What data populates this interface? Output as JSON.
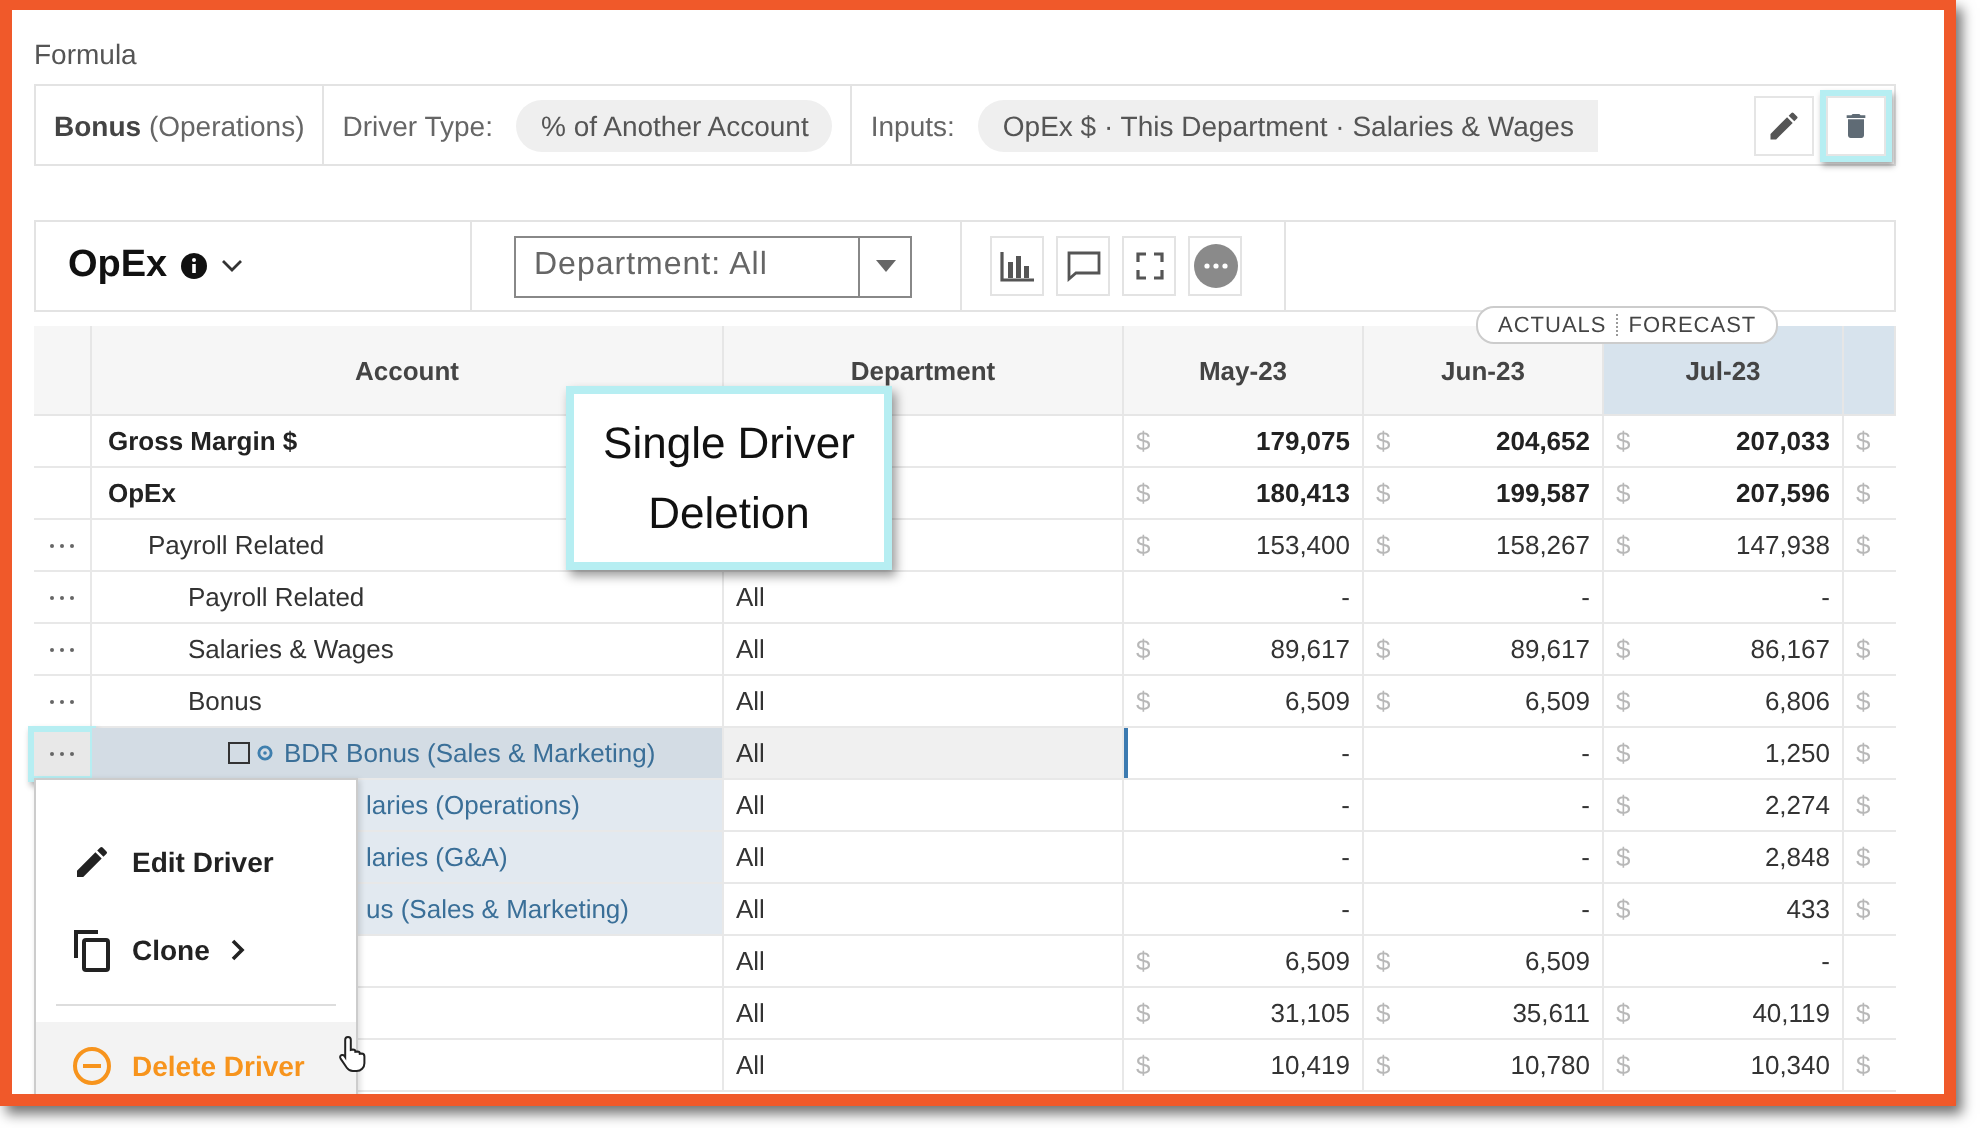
{
  "formula": {
    "label": "Formula",
    "account": "**Bonus** (Operations)",
    "driver_type_label": "Driver Type:",
    "driver_type": "% of Another Account",
    "inputs_label": "Inputs:",
    "inputs": "OpEx $ · This Department · Salaries & Wages",
    "delete_highlighted": true
  },
  "toolbar": {
    "title": "OpEx",
    "department_select": "Department: All"
  },
  "period_pill": {
    "left": "ACTUALS",
    "right": "FORECAST"
  },
  "columns": [
    {
      "forecast": false
    },
    {
      "label": "Account",
      "forecast": false
    },
    {
      "label": "Department",
      "forecast": false
    },
    {
      "label": "May-23",
      "forecast": false
    },
    {
      "label": "Jun-23",
      "forecast": false
    },
    {
      "label": "Jul-23",
      "forecast": true
    },
    {
      "forecast": true
    }
  ],
  "rows": [
    {
      "kind": "account",
      "account": "Gross Margin $",
      "bold": true,
      "menu": false,
      "selected": false,
      "values": [
        {
          "sign": "$",
          "value": "179,075"
        },
        {
          "sign": "$",
          "value": "204,652"
        },
        {
          "sign": "$",
          "value": "207,033"
        },
        {
          "sign": "$"
        }
      ]
    },
    {
      "kind": "account",
      "account": "OpEx",
      "bold": true,
      "menu": false,
      "selected": false,
      "values": [
        {
          "sign": "$",
          "value": "180,413"
        },
        {
          "sign": "$",
          "value": "199,587"
        },
        {
          "sign": "$",
          "value": "207,596"
        },
        {
          "sign": "$"
        }
      ],
      "children": [
        {
          "kind": "account",
          "account": "Payroll Related",
          "bold": false,
          "menu": true,
          "selected": false,
          "values": [
            {
              "sign": "$",
              "value": "153,400"
            },
            {
              "sign": "$",
              "value": "158,267"
            },
            {
              "sign": "$",
              "value": "147,938"
            },
            {
              "sign": "$"
            }
          ],
          "children": [
            {
              "kind": "account",
              "account": "Payroll Related",
              "department": "All",
              "bold": false,
              "menu": true,
              "selected": false,
              "values": [
                {
                  "value": "-"
                },
                {
                  "value": "-"
                },
                {
                  "value": "-"
                }
              ]
            },
            {
              "kind": "account",
              "account": "Salaries & Wages",
              "department": "All",
              "bold": false,
              "menu": true,
              "selected": false,
              "values": [
                {
                  "sign": "$",
                  "value": "89,617"
                },
                {
                  "sign": "$",
                  "value": "89,617"
                },
                {
                  "sign": "$",
                  "value": "86,167"
                },
                {
                  "sign": "$"
                }
              ]
            },
            {
              "kind": "account",
              "account": "Bonus",
              "department": "All",
              "bold": false,
              "menu": true,
              "selected": false,
              "values": [
                {
                  "sign": "$",
                  "value": "6,509"
                },
                {
                  "sign": "$",
                  "value": "6,509"
                },
                {
                  "sign": "$",
                  "value": "6,806"
                },
                {
                  "sign": "$"
                }
              ],
              "children": [
                {
                  "kind": "driver",
                  "account": "BDR Bonus (Sales & Marketing)",
                  "department": "All",
                  "bold": false,
                  "menu": true,
                  "selected": true,
                  "values": [
                    {
                      "value": "-"
                    },
                    {
                      "value": "-"
                    },
                    {
                      "sign": "$",
                      "value": "1,250"
                    },
                    {
                      "sign": "$"
                    }
                  ]
                },
                {
                  "kind": "driver_cut",
                  "account": "laries (Operations)",
                  "department": "All",
                  "bold": false,
                  "selected": false,
                  "values": [
                    {
                      "value": "-"
                    },
                    {
                      "value": "-"
                    },
                    {
                      "sign": "$",
                      "value": "2,274"
                    },
                    {
                      "sign": "$"
                    }
                  ]
                },
                {
                  "kind": "driver_cut",
                  "account": "laries (G&A)",
                  "department": "All",
                  "bold": false,
                  "selected": false,
                  "values": [
                    {
                      "value": "-"
                    },
                    {
                      "value": "-"
                    },
                    {
                      "sign": "$",
                      "value": "2,848"
                    },
                    {
                      "sign": "$"
                    }
                  ]
                },
                {
                  "kind": "driver_cut",
                  "account": "us (Sales & Marketing)",
                  "department": "All",
                  "bold": false,
                  "selected": false,
                  "values": [
                    {
                      "value": "-"
                    },
                    {
                      "value": "-"
                    },
                    {
                      "sign": "$",
                      "value": "433"
                    },
                    {
                      "sign": "$"
                    }
                  ]
                }
              ]
            }
          ]
        }
      ]
    },
    {
      "kind": "account",
      "department": "All",
      "selected": false,
      "values": [
        {
          "sign": "$",
          "value": "6,509"
        },
        {
          "sign": "$",
          "value": "6,509"
        },
        {
          "value": "-"
        }
      ]
    },
    {
      "kind": "account",
      "department": "All",
      "selected": false,
      "values": [
        {
          "sign": "$",
          "value": "31,105"
        },
        {
          "sign": "$",
          "value": "35,611"
        },
        {
          "sign": "$",
          "value": "40,119"
        },
        {
          "sign": "$"
        }
      ]
    },
    {
      "kind": "account",
      "department": "All",
      "selected": false,
      "values": [
        {
          "sign": "$",
          "value": "10,419"
        },
        {
          "sign": "$",
          "value": "10,780"
        },
        {
          "sign": "$",
          "value": "10,340"
        },
        {
          "sign": "$"
        }
      ]
    }
  ],
  "context_menu": {
    "items": [
      {
        "kind": "edit",
        "label": "Edit Driver",
        "hovered": false
      },
      {
        "kind": "clone",
        "label": "Clone",
        "submenu": true,
        "hovered": false
      },
      {
        "kind": "delete",
        "label": "Delete Driver",
        "hovered": true
      }
    ]
  },
  "callout": {
    "text": "Single Driver Deletion"
  }
}
